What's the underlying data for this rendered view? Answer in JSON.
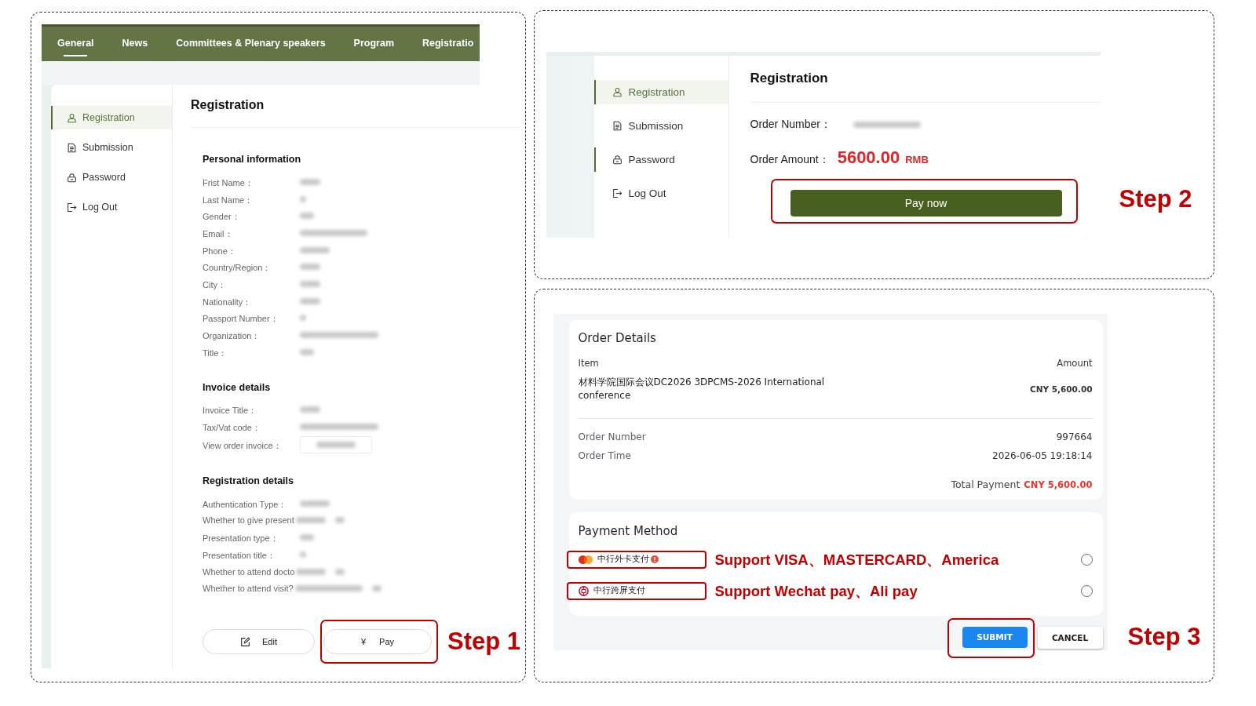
{
  "step_1": {
    "nav": [
      {
        "label": "General",
        "selected": true
      },
      {
        "label": "News",
        "selected": false
      },
      {
        "label": "Committees & Plenary speakers",
        "selected": false
      },
      {
        "label": "Program",
        "selected": false
      },
      {
        "label": "Registratio",
        "selected": false
      }
    ],
    "sidebar": [
      {
        "kind": "user",
        "label": "Registration",
        "selected": true,
        "indicator": true
      },
      {
        "kind": "document",
        "label": "Submission",
        "selected": false,
        "indicator": false
      },
      {
        "kind": "lock",
        "label": "Password",
        "selected": false,
        "indicator": false
      },
      {
        "kind": "logout",
        "label": "Log Out",
        "selected": false,
        "indicator": false
      }
    ],
    "title": "Registration",
    "sections": [
      {
        "heading": "Personal information",
        "fields": [
          {
            "label": "Frist Name：",
            "kind": "blurred"
          },
          {
            "label": "Last Name：",
            "kind": "blurred"
          },
          {
            "label": "Gender：",
            "kind": "blurred"
          },
          {
            "label": "Email：",
            "kind": "blurred"
          },
          {
            "label": "Phone：",
            "kind": "blurred"
          },
          {
            "label": "Country/Region：",
            "kind": "blurred"
          },
          {
            "label": "City：",
            "kind": "blurred"
          },
          {
            "label": "Nationality：",
            "kind": "blurred"
          },
          {
            "label": "Passport Number：",
            "kind": "blurred"
          },
          {
            "label": "Organization：",
            "kind": "blurred"
          },
          {
            "label": "Title：",
            "kind": "blurred"
          }
        ]
      },
      {
        "heading": "Invoice details",
        "fields": [
          {
            "label": "Invoice Title：",
            "kind": "blurred"
          },
          {
            "label": "Tax/Vat code：",
            "kind": "blurred"
          },
          {
            "label": "View order invoice：",
            "kind": "button"
          }
        ]
      },
      {
        "heading": "Registration details",
        "fields": [
          {
            "label": "Authentication Type：",
            "kind": "blurred"
          },
          {
            "label": "Whether to give present",
            "kind": "pair"
          },
          {
            "label": "Presentation type：",
            "kind": "blurred"
          },
          {
            "label": "Presentation title：",
            "kind": "blurred"
          },
          {
            "label": "Whether to attend docto",
            "kind": "pair"
          },
          {
            "label": "Whether to attend visit?",
            "kind": "pair"
          }
        ]
      }
    ],
    "buttons": [
      {
        "kind": "edit",
        "label": "Edit",
        "highlighted": false
      },
      {
        "kind": "pay",
        "icon": "¥",
        "label": "Pay",
        "highlighted": true
      }
    ],
    "step_label": "Step 1"
  },
  "step_2": {
    "sidebar": [
      {
        "kind": "user",
        "label": "Registration",
        "selected": true,
        "indicator": true
      },
      {
        "kind": "document",
        "label": "Submission",
        "selected": false,
        "indicator": false
      },
      {
        "kind": "lock",
        "label": "Password",
        "selected": false,
        "indicator": true
      },
      {
        "kind": "logout",
        "label": "Log Out",
        "selected": false,
        "indicator": false
      }
    ],
    "title": "Registration",
    "order_number": {
      "label": "Order Number：",
      "kind": "blurred"
    },
    "order_amount": {
      "label": "Order Amount：",
      "amount": "5600.00",
      "currency": "RMB"
    },
    "button": {
      "label": "Pay now",
      "highlighted": true
    },
    "step_label": "Step 2"
  },
  "step_3": {
    "order_details": {
      "title": "Order Details",
      "columns": [
        "Item",
        "Amount"
      ],
      "item": {
        "name": "材料学院国际会议DC2026 3DPCMS-2026 International conference",
        "amount": "CNY 5,600.00"
      },
      "info": [
        {
          "label": "Order Number",
          "value": "997664"
        },
        {
          "label": "Order Time",
          "value": "2026-06-05 19:18:14"
        }
      ],
      "total": {
        "label": "Total Payment",
        "value": "CNY 5,600.00"
      }
    },
    "payment_method": {
      "title": "Payment Method",
      "options": [
        {
          "kind": "card",
          "label": "中行外卡支付",
          "alert": true,
          "highlighted": true,
          "note": "Support VISA、MASTERCARD、America",
          "selected": false
        },
        {
          "kind": "bank",
          "label": "中行跨屏支付",
          "alert": false,
          "highlighted": true,
          "note": "Support Wechat pay、Ali pay",
          "selected": false
        }
      ]
    },
    "buttons": [
      {
        "kind": "primary",
        "label": "SUBMIT",
        "highlighted": true
      },
      {
        "kind": "secondary",
        "label": "CANCEL",
        "highlighted": false
      }
    ],
    "step_label": "Step 3"
  }
}
